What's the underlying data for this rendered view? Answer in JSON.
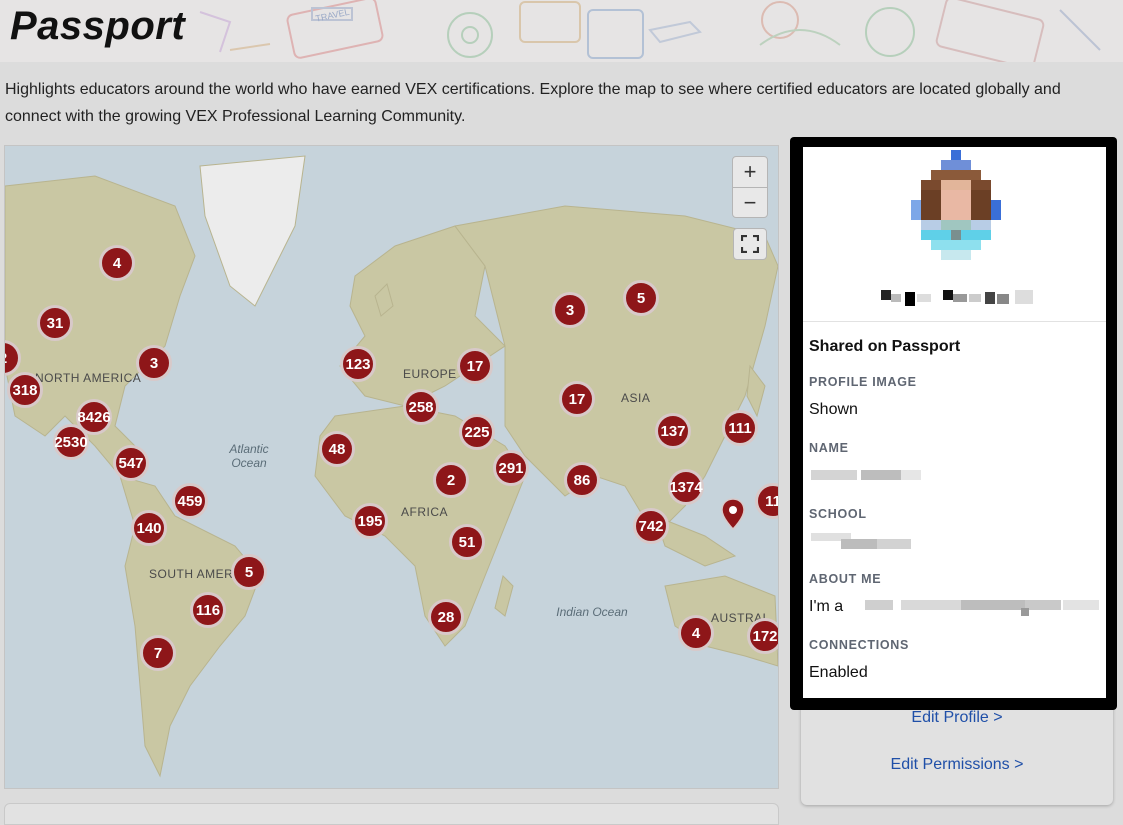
{
  "page": {
    "title": "Passport",
    "intro": "Highlights educators around the world who have earned VEX certifications. Explore the map to see where certified educators are located globally and connect with the growing VEX Professional Learning Community."
  },
  "banner": {
    "badge_text": "TRAVEL"
  },
  "map": {
    "zoom_in": "+",
    "zoom_out": "−",
    "continent_labels": [
      "NORTH AMERICA",
      "EUROPE",
      "ASIA",
      "AFRICA",
      "SOUTH AMER",
      "AUSTRAL"
    ],
    "ocean_labels": [
      "Atlantic Ocean",
      "Indian Ocean"
    ],
    "clusters": [
      "4",
      "31",
      "2",
      "318",
      "3",
      "8426",
      "2530",
      "547",
      "459",
      "140",
      "5",
      "116",
      "7",
      "123",
      "17",
      "258",
      "48",
      "225",
      "2",
      "291",
      "195",
      "51",
      "28",
      "3",
      "5",
      "17",
      "86",
      "137",
      "111",
      "1374",
      "742",
      "11",
      "4",
      "172"
    ]
  },
  "profile": {
    "section_title": "Shared on Passport",
    "fields": [
      {
        "label": "PROFILE IMAGE",
        "value": "Shown"
      },
      {
        "label": "NAME",
        "value": ""
      },
      {
        "label": "SCHOOL",
        "value": ""
      },
      {
        "label": "ABOUT ME",
        "value": "I'm a"
      },
      {
        "label": "CONNECTIONS",
        "value": "Enabled"
      }
    ]
  },
  "side_links": {
    "edit_profile": "Edit Profile >",
    "edit_permissions": "Edit Permissions >"
  },
  "colors": {
    "marker": "#8e1619",
    "link": "#1f4fa8",
    "frame": "#000000"
  }
}
